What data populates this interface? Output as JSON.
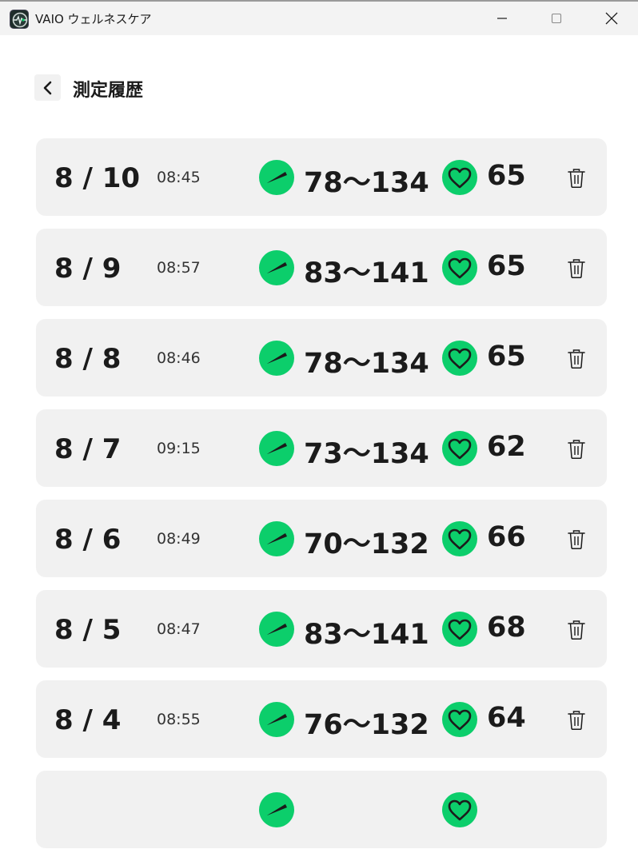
{
  "window": {
    "title": "VAIO ウェルネスケア",
    "icon": "app-logo-icon",
    "controls": [
      "minimize-icon",
      "maximize-icon",
      "close-icon"
    ]
  },
  "header": {
    "back_icon": "chevron-left-icon",
    "title": "測定履歴"
  },
  "colors": {
    "accent": "#0cce6b",
    "row_background": "#f1f1f1",
    "titlebar_background": "#f3f3f3"
  },
  "records": [
    {
      "date": "8 / 10",
      "time": "08:45",
      "blood_pressure": "78〜134",
      "heart_rate": "65"
    },
    {
      "date": "8 / 9",
      "time": "08:57",
      "blood_pressure": "83〜141",
      "heart_rate": "65"
    },
    {
      "date": "8 / 8",
      "time": "08:46",
      "blood_pressure": "78〜134",
      "heart_rate": "65"
    },
    {
      "date": "8 / 7",
      "time": "09:15",
      "blood_pressure": "73〜134",
      "heart_rate": "62"
    },
    {
      "date": "8 / 6",
      "time": "08:49",
      "blood_pressure": "70〜132",
      "heart_rate": "66"
    },
    {
      "date": "8 / 5",
      "time": "08:47",
      "blood_pressure": "83〜141",
      "heart_rate": "68"
    },
    {
      "date": "8 / 4",
      "time": "08:55",
      "blood_pressure": "76〜132",
      "heart_rate": "64"
    },
    {
      "date": "",
      "time": "",
      "blood_pressure": "",
      "heart_rate": ""
    }
  ],
  "row_icons": {
    "blood_pressure": "gauge-icon",
    "heart_rate": "heart-icon",
    "delete": "trash-icon"
  }
}
